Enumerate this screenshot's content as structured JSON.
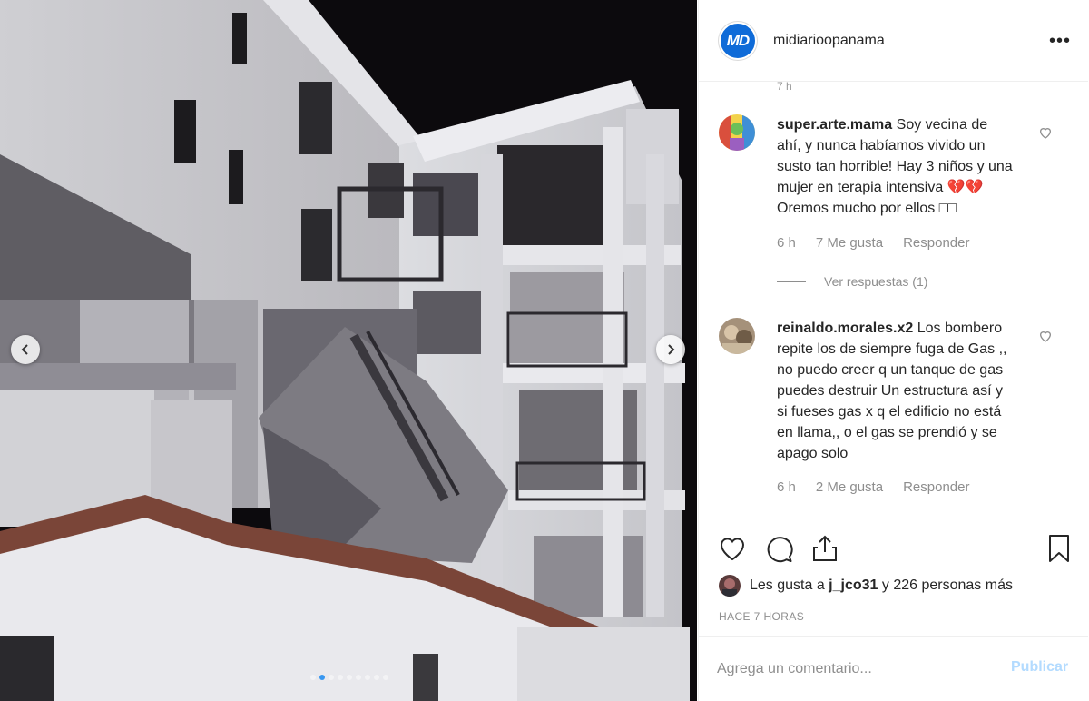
{
  "post": {
    "account": {
      "username": "midiarioopanama",
      "logo_text": "MD",
      "brand_color": "#0f6bd8"
    },
    "more_options": "•••",
    "peek_time": "7 h",
    "comments": [
      {
        "author": "super.arte.mama",
        "text": "Soy vecina de ahí, y nunca habíamos vivido un susto tan horrible! Hay 3 niños y una mujer en terapia intensiva 💔💔 Oremos mucho por ellos □□",
        "time": "6 h",
        "likes": "7 Me gusta",
        "reply": "Responder",
        "view_replies": "Ver respuestas (1)"
      },
      {
        "author": "reinaldo.morales.x2",
        "text": "Los bombero repite los de siempre fuga de Gas ,, no puedo creer q un tanque de gas puedes destruir Un estructura así y si fueses gas x q el edificio no está en llama,, o el gas se prendió y se apago solo",
        "time": "6 h",
        "likes": "2 Me gusta",
        "reply": "Responder"
      }
    ],
    "likes_text_prefix": "Les gusta a ",
    "likes_user": "j_jco31",
    "likes_text_suffix": " y 226 personas más",
    "timestamp": "HACE 7 HORAS",
    "comment_input": {
      "placeholder": "Agrega un comentario...",
      "value": ""
    },
    "post_button": "Publicar",
    "post_button_color": "#b3dbff"
  },
  "carousel": {
    "slide_count": 9,
    "active_index": 1,
    "active_color": "#3897f0"
  },
  "icons": {
    "prev": "chevron-left-icon",
    "next": "chevron-right-icon",
    "like": "heart-icon",
    "comment": "comment-icon",
    "share": "share-icon",
    "save": "bookmark-icon"
  }
}
